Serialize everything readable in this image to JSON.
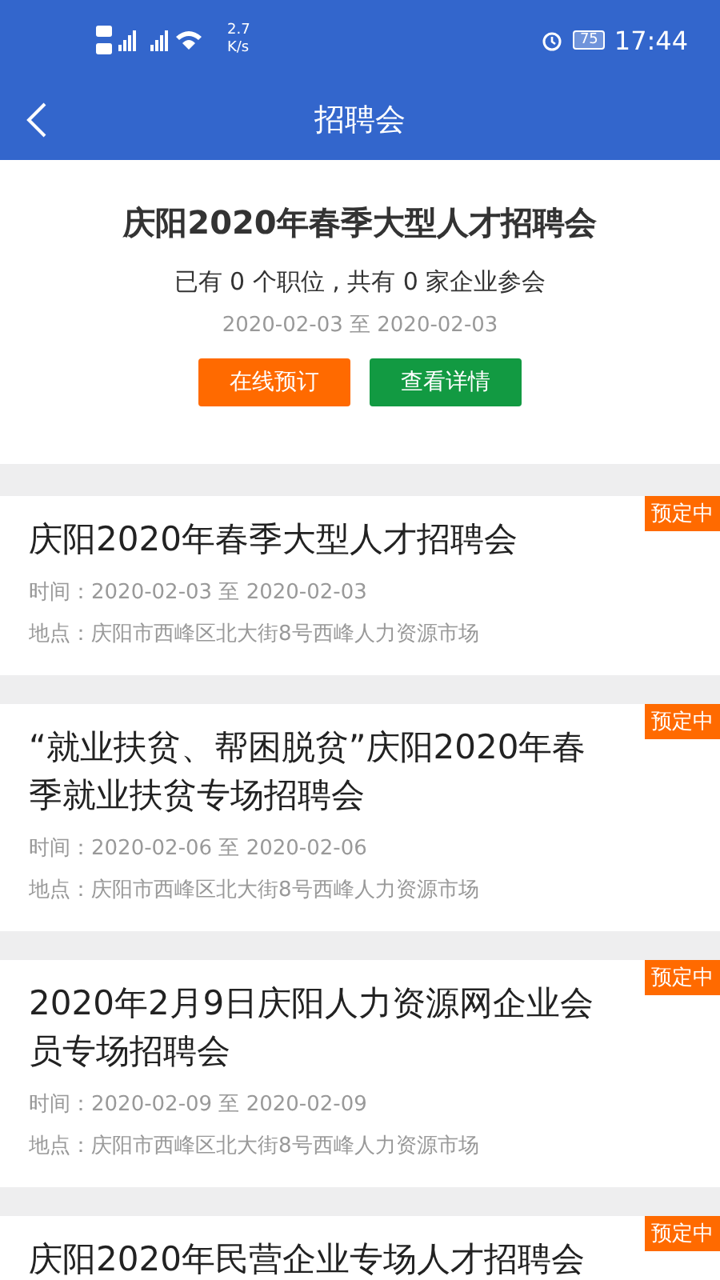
{
  "status_bar": {
    "network_speed": "2.7",
    "network_unit": "K/s",
    "battery": "75",
    "time": "17:44"
  },
  "nav": {
    "title": "招聘会"
  },
  "featured": {
    "title": "庆阳2020年春季大型人才招聘会",
    "summary": "已有 0 个职位 , 共有 0 家企业参会",
    "dates": "2020-02-03 至 2020-02-03",
    "buttons": [
      {
        "label": "在线预订",
        "kind": "book"
      },
      {
        "label": "查看详情",
        "kind": "details"
      }
    ]
  },
  "fairs": [
    {
      "title": "庆阳2020年春季大型人才招聘会",
      "time": "时间：2020-02-03 至 2020-02-03",
      "place": "地点：庆阳市西峰区北大街8号西峰人力资源市场",
      "badge": "预定中"
    },
    {
      "title": "“就业扶贫、帮困脱贫”庆阳2020年春季就业扶贫专场招聘会",
      "time": "时间：2020-02-06 至 2020-02-06",
      "place": "地点：庆阳市西峰区北大街8号西峰人力资源市场",
      "badge": "预定中"
    },
    {
      "title": "2020年2月9日庆阳人力资源网企业会员专场招聘会",
      "time": "时间：2020-02-09 至 2020-02-09",
      "place": "地点：庆阳市西峰区北大街8号西峰人力资源市场",
      "badge": "预定中"
    },
    {
      "title": "庆阳2020年民营企业专场人才招聘会",
      "badge": "预定中"
    }
  ]
}
